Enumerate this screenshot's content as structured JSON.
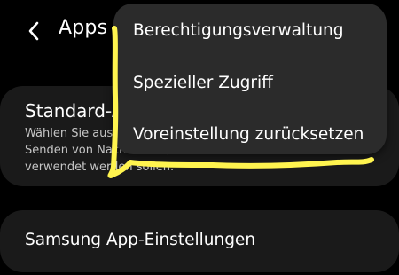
{
  "header": {
    "back_icon": "chevron-left-icon",
    "title": "Apps"
  },
  "standard_apps": {
    "title": "Standard-Apps",
    "description": "Wählen Sie aus, welche Apps zum Tätigen von Anrufen, das Senden von Nachrichten, Aufrufen von Websites und mehr verwendet werden sollen."
  },
  "samsung_settings": {
    "label": "Samsung App-Einstellungen"
  },
  "overflow_menu": {
    "items": [
      {
        "label": "Berechtigungsverwaltung"
      },
      {
        "label": "Spezieller Zugriff"
      },
      {
        "label": "Voreinstellung zurücksetzen"
      }
    ]
  },
  "annotation": {
    "color": "#fff44f"
  }
}
